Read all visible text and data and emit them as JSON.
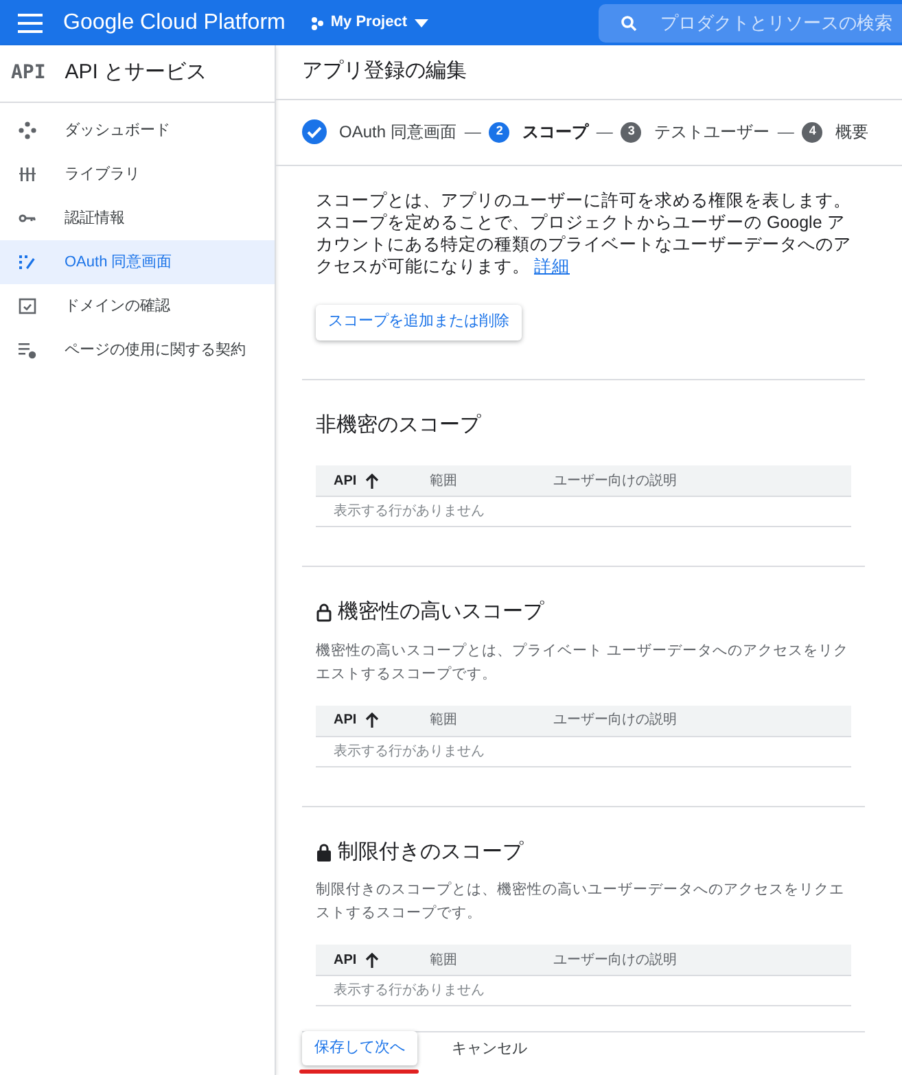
{
  "topbar": {
    "product": "Google Cloud Platform",
    "project": "My Project",
    "search": {
      "placeholder": "プロダクトとリソースの検索"
    }
  },
  "sidebar": {
    "logo": "API",
    "title": "API とサービス",
    "items": [
      {
        "label": "ダッシュボード",
        "kind": "dashboard",
        "selected": false
      },
      {
        "label": "ライブラリ",
        "kind": "library",
        "selected": false
      },
      {
        "label": "認証情報",
        "kind": "key",
        "selected": false
      },
      {
        "label": "OAuth 同意画面",
        "kind": "consent",
        "selected": true
      },
      {
        "label": "ドメインの確認",
        "kind": "domain",
        "selected": false
      },
      {
        "label": "ページの使用に関する契約",
        "kind": "settings",
        "selected": false
      }
    ]
  },
  "page_title": "アプリ登録の編集",
  "stepper_separator": "—",
  "stepper": [
    {
      "label": "OAuth 同意画面",
      "done": true,
      "selected": false
    },
    {
      "number": "2",
      "label": "スコープ",
      "done": false,
      "selected": true
    },
    {
      "number": "3",
      "label": "テストユーザー",
      "done": false,
      "selected": false
    },
    {
      "number": "4",
      "label": "概要",
      "done": false,
      "selected": false
    }
  ],
  "intro": {
    "text": "スコープとは、アプリのユーザーに許可を求める権限を表します。スコープを定めることで、プロジェクトからユーザーの Google アカウントにある特定の種類のプライベートなユーザーデータへのアクセスが可能になります。",
    "link": "詳細"
  },
  "add_button": "スコープを追加または削除",
  "sections": [
    {
      "title": "非機密のスコープ",
      "columns": [
        {
          "label": "API",
          "sorted": true
        },
        {
          "label": "範囲",
          "sorted": false
        },
        {
          "label": "ユーザー向けの説明",
          "sorted": false
        }
      ],
      "empty": "表示する行がありません"
    },
    {
      "title": "機密性の高いスコープ",
      "kind": "sensitive",
      "description": "機密性の高いスコープとは、プライベート ユーザーデータへのアクセスをリクエストするスコープです。",
      "columns": [
        {
          "label": "API",
          "sorted": true
        },
        {
          "label": "範囲",
          "sorted": false
        },
        {
          "label": "ユーザー向けの説明",
          "sorted": false
        }
      ],
      "empty": "表示する行がありません"
    },
    {
      "title": "制限付きのスコープ",
      "kind": "restricted",
      "description": "制限付きのスコープとは、機密性の高いユーザーデータへのアクセスをリクエストするスコープです。",
      "columns": [
        {
          "label": "API",
          "sorted": true
        },
        {
          "label": "範囲",
          "sorted": false
        },
        {
          "label": "ユーザー向けの説明",
          "sorted": false
        }
      ],
      "empty": "表示する行がありません"
    }
  ],
  "actions": {
    "save": "保存して次へ",
    "cancel": "キャンセル"
  }
}
